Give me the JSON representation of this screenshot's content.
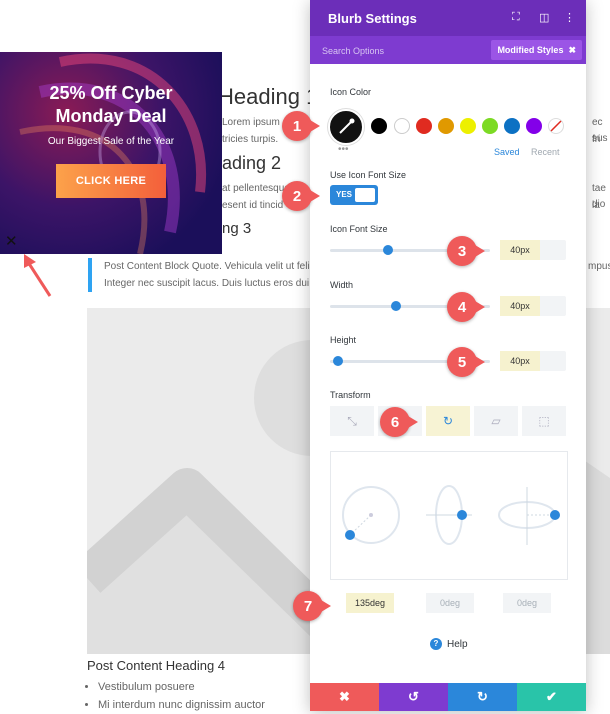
{
  "colors": {
    "panel_header": "#6c2eb9",
    "panel_subbar": "#7e3bd0",
    "accent_blue": "#2b87da",
    "callout_red": "#ef5a5a",
    "footer": [
      "#ef5a5a",
      "#7e3bd0",
      "#2b87da",
      "#29c4a9"
    ],
    "swatches": [
      "#000000",
      "#ffffff",
      "#e02b20",
      "#e09900",
      "#edf000",
      "#7cda24",
      "#0c71c3",
      "#8300e9"
    ]
  },
  "background": {
    "heading1": "Heading 1",
    "para1_lines": [
      "Lorem ipsum",
      "tricies turpis."
    ],
    "heading2": "ading 2",
    "para2_lines": [
      "at pellentesque",
      "esent id tincid"
    ],
    "heading3": "ng 3",
    "right_fragments": [
      "ec fri",
      "sus",
      "tae la",
      "dio"
    ],
    "quote_lines": [
      "Post Content Block Quote. Vehicula velit ut felis",
      "Integer nec suscipit lacus. Duis luctus eros dui"
    ],
    "quote_right_fragment": "mpus",
    "heading4": "Post Content Heading 4",
    "bullets": [
      "Vestibulum posuere",
      "Mi interdum nunc dignissim auctor"
    ]
  },
  "promo": {
    "title_line1": "25% Off Cyber",
    "title_line2": "Monday Deal",
    "subtitle": "Our Biggest Sale of the Year",
    "button": "CLICK HERE",
    "close_glyph": "✕"
  },
  "panel": {
    "title": "Blurb Settings",
    "search_placeholder": "Search Options",
    "modified_styles": "Modified Styles",
    "modified_close": "✖",
    "icon_color_label": "Icon Color",
    "saved_tab": "Saved",
    "recent_tab": "Recent",
    "use_icon_font_size_label": "Use Icon Font Size",
    "toggle_value": "YES",
    "icon_font_size": {
      "label": "Icon Font Size",
      "value": "40px",
      "level": 0.33
    },
    "width": {
      "label": "Width",
      "value": "40px",
      "level": 0.38
    },
    "height": {
      "label": "Height",
      "value": "40px",
      "level": 0.02
    },
    "transform_label": "Transform",
    "deg_values": [
      "135deg",
      "0deg",
      "0deg"
    ],
    "help": "Help",
    "footer_icons": [
      "✖",
      "↺",
      "↻",
      "✔"
    ]
  },
  "callouts": [
    "1",
    "2",
    "3",
    "4",
    "5",
    "6",
    "7"
  ]
}
